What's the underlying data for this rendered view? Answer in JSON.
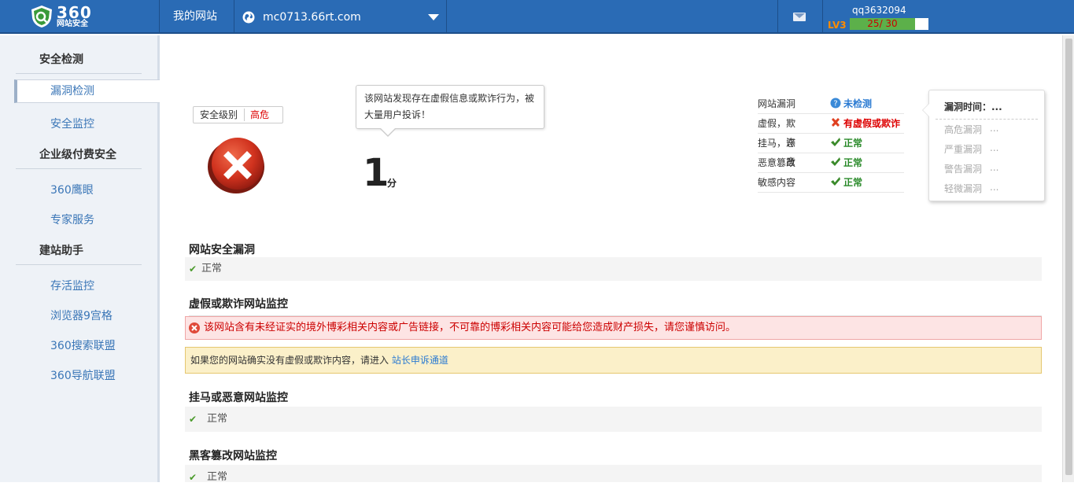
{
  "brand": {
    "logo_main": "360",
    "logo_sub": "网站安全"
  },
  "topbar": {
    "my_site": "我的网站",
    "domain": "mc0713.66rt.com",
    "username": "qq3632094",
    "level": "LV3",
    "exp_label": "25/ 30",
    "exp_progress": 0.83,
    "icons": [
      "globe-icon",
      "chevron-down-icon",
      "mail-icon"
    ]
  },
  "sidebar": {
    "groups": [
      {
        "label": "安全检测",
        "items": [
          "漏洞检测",
          "安全监控"
        ]
      },
      {
        "label": "企业级付费安全",
        "items": [
          "360鹰眼",
          "专家服务"
        ]
      },
      {
        "label": "建站助手",
        "items": [
          "存活监控",
          "浏览器9宫格",
          "360搜索联盟",
          "360导航联盟"
        ]
      }
    ],
    "active": "漏洞检测"
  },
  "summary": {
    "level_label": "安全级别",
    "level_value": "高危",
    "tooltip": "该网站发现存在虚假信息或欺诈行为，被大量用户投诉！",
    "score": "1",
    "score_unit": "分"
  },
  "status": [
    {
      "key": "网站漏洞",
      "value": "未检测",
      "state": "unknown"
    },
    {
      "key": "虚假，欺诈",
      "value": "有虚假或欺诈",
      "state": "danger"
    },
    {
      "key": "挂马，恶意",
      "value": "正常",
      "state": "ok"
    },
    {
      "key": "恶意篡改",
      "value": "正常",
      "state": "ok"
    },
    {
      "key": "敏感内容",
      "value": "正常",
      "state": "ok"
    }
  ],
  "vuln_panel": {
    "title": "漏洞时间：...",
    "rows": [
      {
        "label": "高危漏洞",
        "value": "..."
      },
      {
        "label": "严重漏洞",
        "value": "..."
      },
      {
        "label": "警告漏洞",
        "value": "..."
      },
      {
        "label": "轻微漏洞",
        "value": "..."
      }
    ]
  },
  "sections": {
    "s1_title": "网站安全漏洞",
    "s1_status": "正常",
    "s2_title": "虚假或欺诈网站监控",
    "s2_alert": "该网站含有未经证实的境外博彩相关内容或广告链接，不可靠的博彩相关内容可能给您造成财产损失，请您谨慎访问。",
    "s2_notice": "如果您的网站确实没有虚假或欺诈内容，请进入",
    "s2_link": "站长申诉通道",
    "s3_title": "挂马或恶意网站监控",
    "s3_status": "正常",
    "s4_title": "黑客篡改网站监控",
    "s4_status": "正常"
  },
  "colors": {
    "topbar": "#2a6bb5",
    "danger": "#dd0000",
    "ok": "#2a8a2a",
    "link": "#2a7ad2"
  }
}
